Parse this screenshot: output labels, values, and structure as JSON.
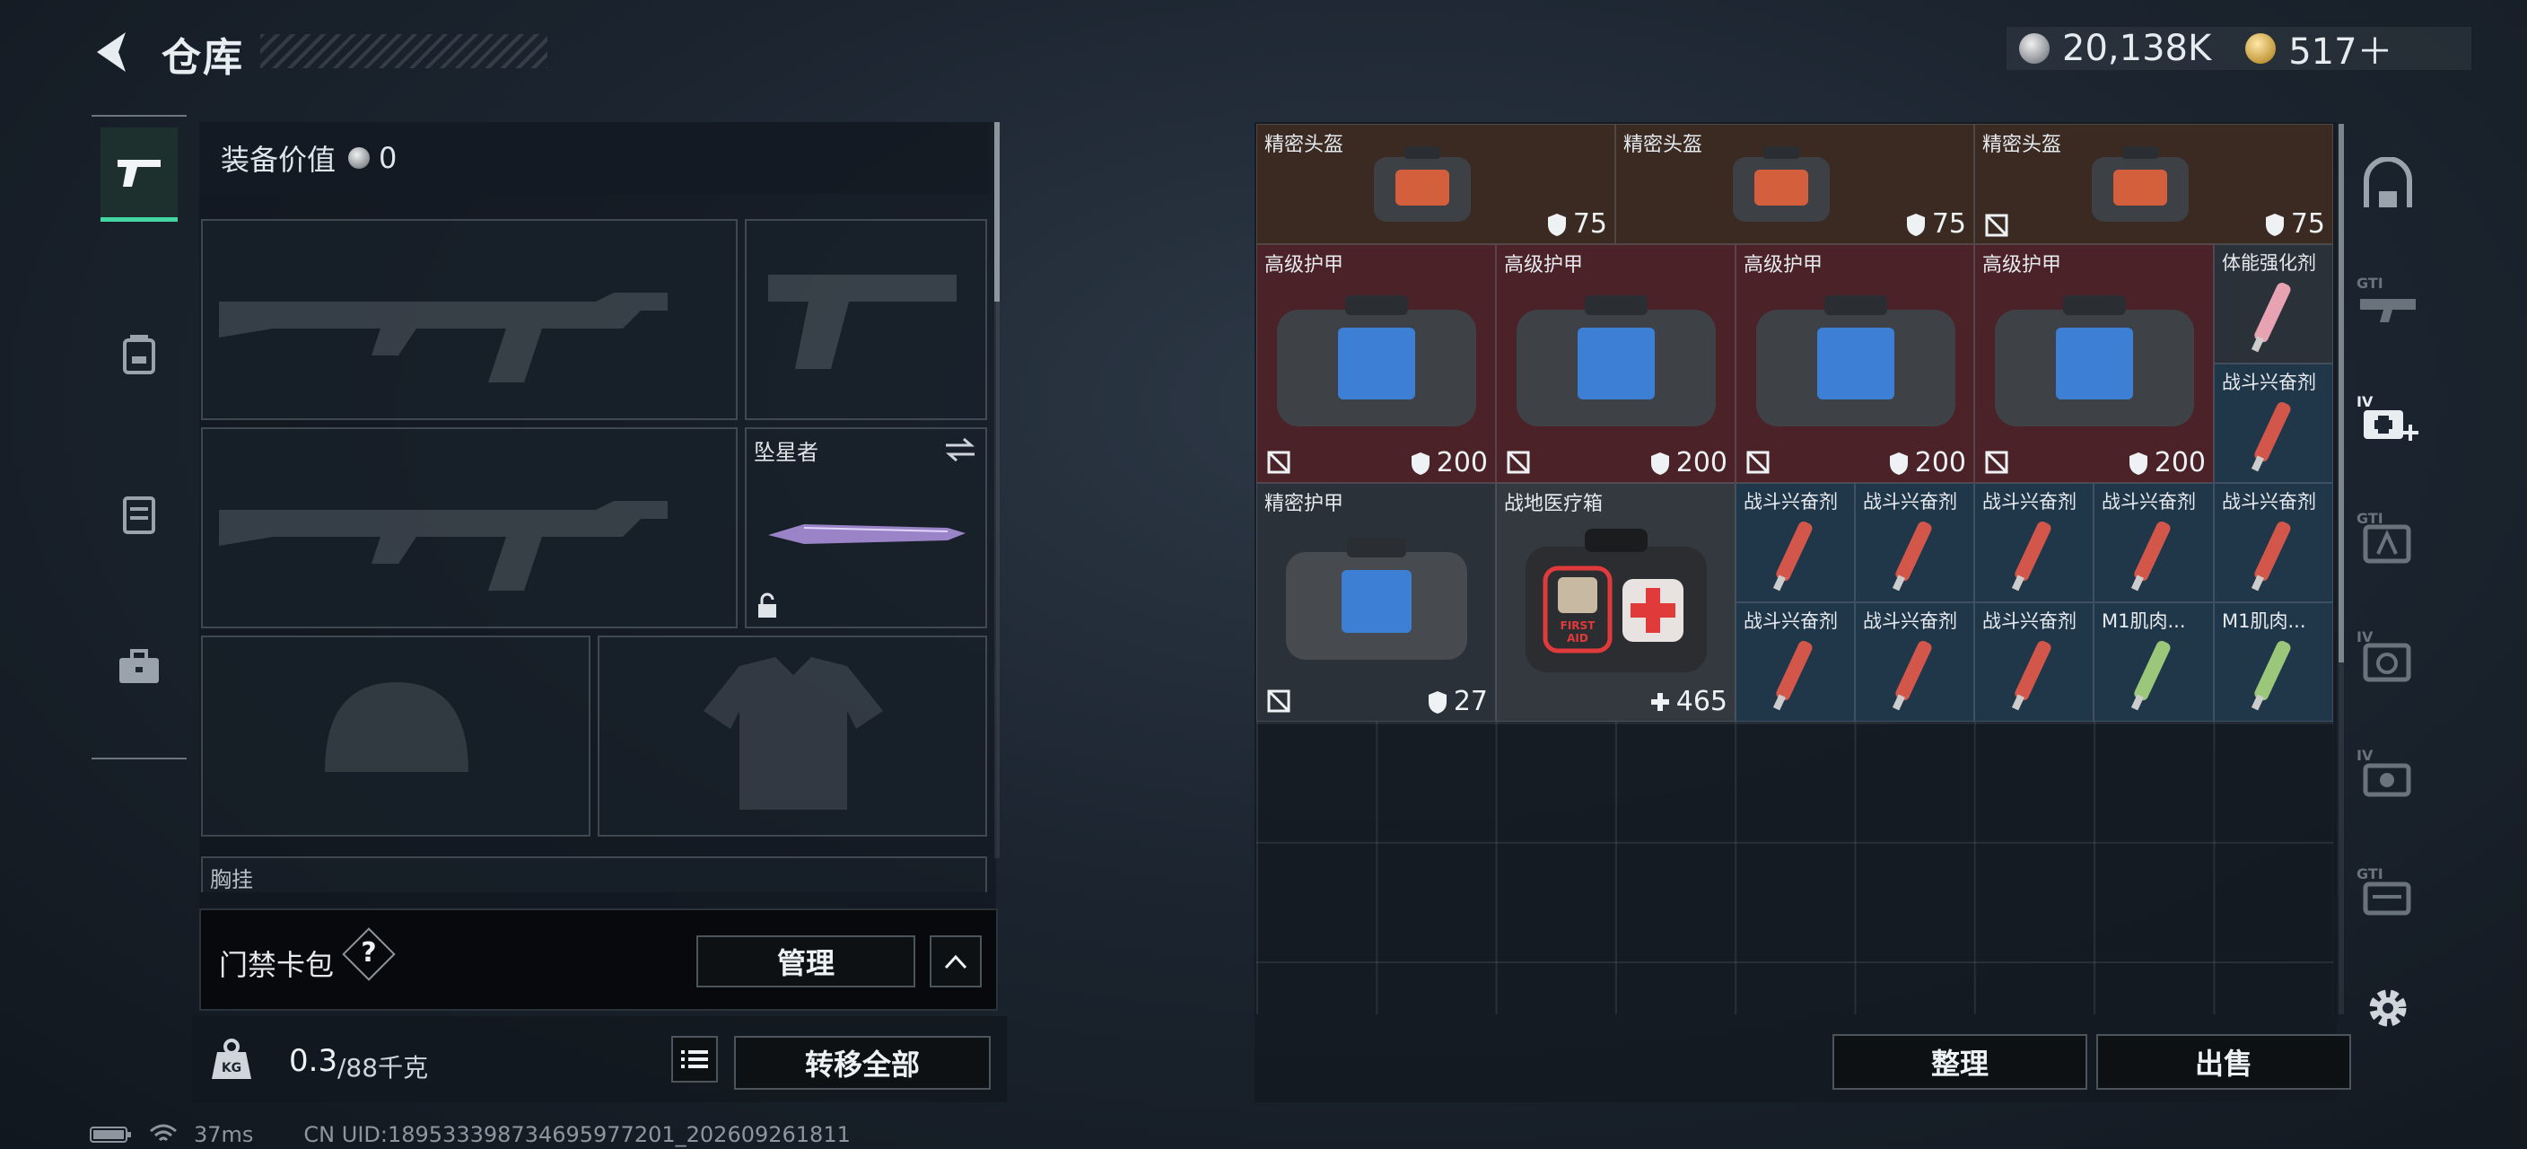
{
  "header": {
    "title": "仓库",
    "silver": "20,138K",
    "gold": "517＋"
  },
  "left_nav": {
    "items": [
      "weapon-tab",
      "backpack-tab",
      "vest-tab",
      "toolbox-tab"
    ]
  },
  "equipment": {
    "value_label": "装备价值",
    "value": "0",
    "melee_name": "坠星者",
    "chest_label": "胸挂",
    "access_card_label": "门禁卡包",
    "help": "?",
    "manage_button": "管理",
    "weight_current": "0.3",
    "weight_max": "/88千克",
    "transfer_all_button": "转移全部"
  },
  "inventory": {
    "items": [
      {
        "name": "精密头盔",
        "value": "75"
      },
      {
        "name": "精密头盔",
        "value": "75"
      },
      {
        "name": "精密头盔",
        "value": "75"
      },
      {
        "name": "高级护甲",
        "value": "200"
      },
      {
        "name": "高级护甲",
        "value": "200"
      },
      {
        "name": "高级护甲",
        "value": "200"
      },
      {
        "name": "高级护甲",
        "value": "200"
      },
      {
        "name": "体能强化剂"
      },
      {
        "name": "战斗兴奋剂"
      },
      {
        "name": "精密护甲",
        "value": "27"
      },
      {
        "name": "战地医疗箱",
        "value": "465"
      },
      {
        "name": "战斗兴奋剂"
      },
      {
        "name": "战斗兴奋剂"
      },
      {
        "name": "战斗兴奋剂"
      },
      {
        "name": "战斗兴奋剂"
      },
      {
        "name": "战斗兴奋剂"
      },
      {
        "name": "战斗兴奋剂"
      },
      {
        "name": "战斗兴奋剂"
      },
      {
        "name": "战斗兴奋剂"
      },
      {
        "name": "M1肌肉..."
      },
      {
        "name": "M1肌肉..."
      }
    ],
    "organize_button": "整理",
    "sell_button": "出售"
  },
  "status_bar": {
    "ping": "37ms",
    "uid": "CN UID:18953339873469597720​1_202609261811"
  },
  "colors": {
    "accent": "#41d6a2",
    "helmet_bg": "#3a2a22",
    "armor_bg": "#4a2228",
    "consumable_bg": "#20374a"
  }
}
